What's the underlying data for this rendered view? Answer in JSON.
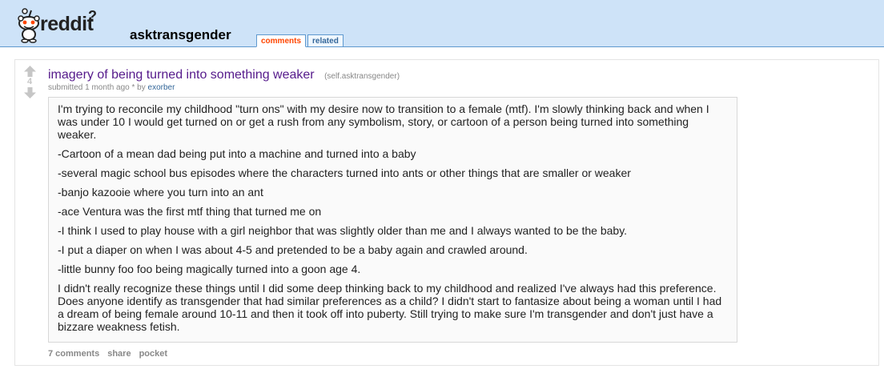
{
  "header": {
    "logo_text": "reddit",
    "subreddit_name": "asktransgender",
    "tabs": [
      {
        "label": "comments",
        "selected": true
      },
      {
        "label": "related",
        "selected": false
      }
    ]
  },
  "post": {
    "score": "4",
    "title": "imagery of being turned into something weaker",
    "domain": "(self.asktransgender)",
    "tagline": {
      "submitted": "submitted 1 month ago * by",
      "author": "exorber"
    },
    "selftext": [
      "I'm trying to reconcile my childhood \"turn ons\" with my desire now to transition to a female (mtf). I'm slowly thinking back and when I was under 10 I would get turned on or get a rush from any symbolism, story, or cartoon of a person being turned into something weaker.",
      "-Cartoon of a mean dad being put into a machine and turned into a baby",
      "-several magic school bus episodes where the characters turned into ants or other things that are smaller or weaker",
      "-banjo kazooie where you turn into an ant",
      "-ace Ventura was the first mtf thing that turned me on",
      "-I think I used to play house with a girl neighbor that was slightly older than me and I always wanted to be the baby.",
      "-I put a diaper on when I was about 4-5 and pretended to be a baby again and crawled around.",
      "-little bunny foo foo being magically turned into a goon age 4.",
      "I didn't really recognize these things until I did some deep thinking back to my childhood and realized I've always had this preference. Does anyone identify as transgender that had similar preferences as a child? I didn't start to fantasize about being a woman until I had a dream of being female around 10-11 and then it took off into puberty. Still trying to make sure I'm transgender and don't just have a bizzare weakness fetish."
    ],
    "buttons": {
      "comments": "7 comments",
      "share": "share",
      "pocket": "pocket"
    }
  },
  "colors": {
    "header_bg": "#cee3f8",
    "title_visited": "#551a8b",
    "tab_selected": "#ff4500",
    "link": "#369"
  },
  "icons": {
    "logo": "reddit-alien-icon",
    "upvote": "upvote-arrow-icon",
    "downvote": "downvote-arrow-icon"
  }
}
